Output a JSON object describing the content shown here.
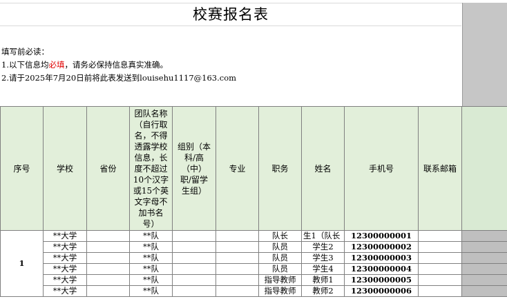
{
  "title": "校赛报名表",
  "notes": {
    "heading": "填写前必读：",
    "line1_prefix": "1.以下信息均",
    "line1_red": "必填",
    "line1_suffix": "，请务必保持信息真实准确。",
    "line2": "2.请于2025年7月20日前将此表发送到louisehu1117@163.com"
  },
  "colors": {
    "header_bg": "#e2efda",
    "gray_col": "#bfbfbf",
    "required_red": "#e00000"
  },
  "table": {
    "headers": [
      "序号",
      "学校",
      "省份",
      "团队名称（自行取名，不得透露学校信息，长度不超过10个汉字或15个英文字母不加书名号）",
      "组别（本科/高（中）职/留学生组）",
      "专业",
      "职务",
      "姓名",
      "手机号",
      "联系邮箱",
      ""
    ],
    "seq": "1",
    "rows": [
      {
        "school": "**大学",
        "team": "**队",
        "role": "队长",
        "name": "生1（队长",
        "phone": "12300000001"
      },
      {
        "school": "**大学",
        "team": "**队",
        "role": "队员",
        "name": "学生2",
        "phone": "12300000002"
      },
      {
        "school": "**大学",
        "team": "**队",
        "role": "队员",
        "name": "学生3",
        "phone": "12300000003"
      },
      {
        "school": "**大学",
        "team": "**队",
        "role": "队员",
        "name": "学生4",
        "phone": "12300000004"
      },
      {
        "school": "**大学",
        "team": "**队",
        "role": "指导教师",
        "name": "教师1",
        "phone": "12300000005"
      },
      {
        "school": "**大学",
        "team": "**队",
        "role": "指导教师",
        "name": "教师2",
        "phone": "12300000006"
      }
    ]
  }
}
